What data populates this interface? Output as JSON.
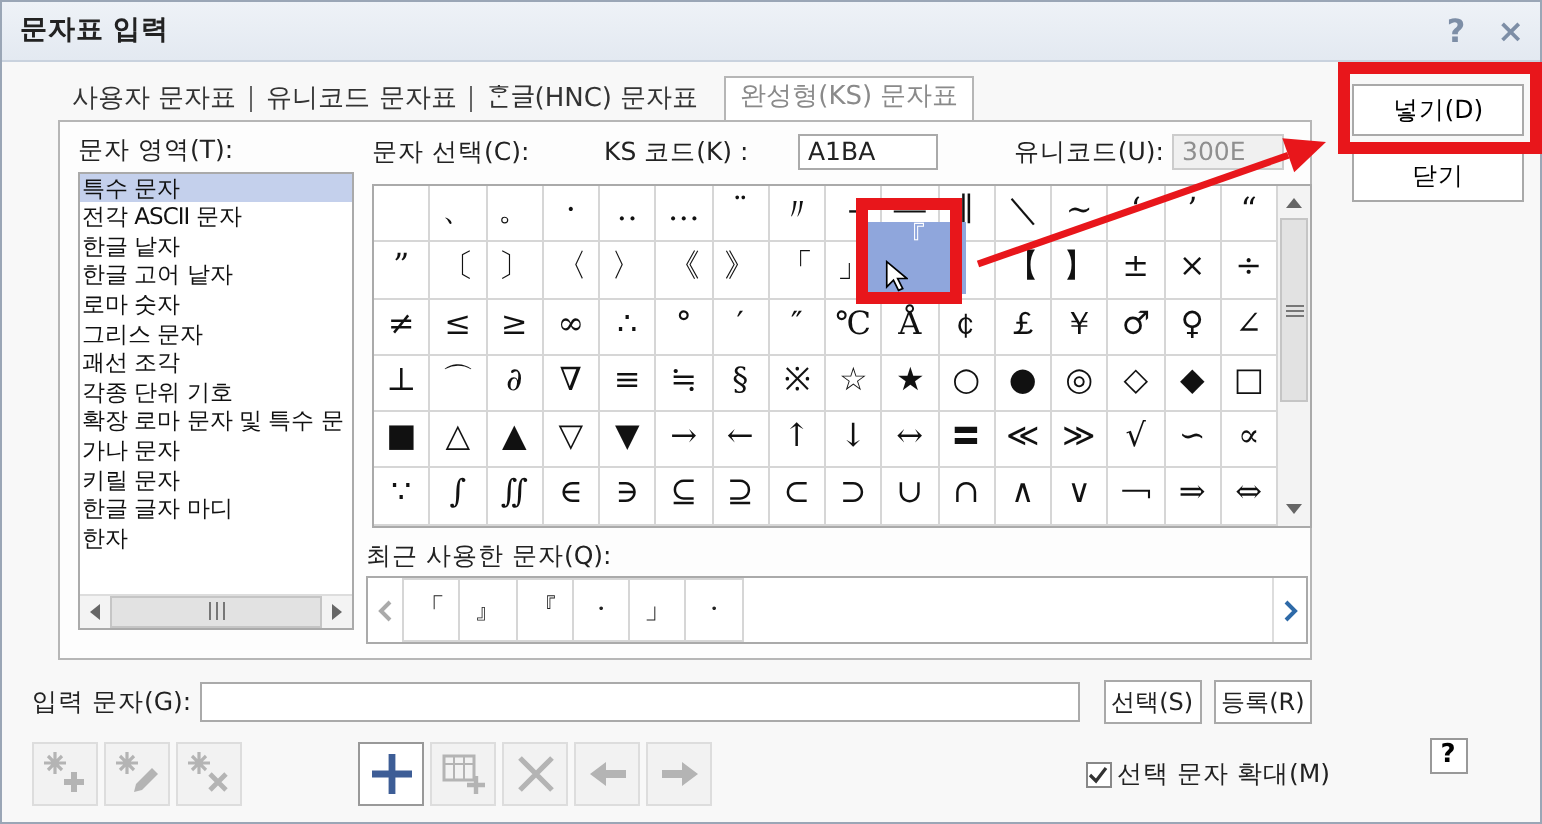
{
  "window": {
    "title": "문자표 입력",
    "help": "?",
    "close": "×"
  },
  "tabs": [
    {
      "label": "사용자 문자표",
      "selected": false
    },
    {
      "label": "유니코드 문자표",
      "selected": false
    },
    {
      "label": "ᄒᆞᆫ글(HNC) 문자표",
      "selected": false
    },
    {
      "label": "완성형(KS) 문자표",
      "selected": true
    }
  ],
  "area": {
    "label": "문자 영역(T):",
    "items": [
      {
        "label": "특수 문자",
        "selected": true
      },
      {
        "label": "전각 ASCII 문자",
        "selected": false
      },
      {
        "label": "한글 낱자",
        "selected": false
      },
      {
        "label": "한글 고어 낱자",
        "selected": false
      },
      {
        "label": "로마 숫자",
        "selected": false
      },
      {
        "label": "그리스 문자",
        "selected": false
      },
      {
        "label": "괘선 조각",
        "selected": false
      },
      {
        "label": "각종 단위 기호",
        "selected": false
      },
      {
        "label": "확장 로마 문자 및 특수 문",
        "selected": false
      },
      {
        "label": "가나 문자",
        "selected": false
      },
      {
        "label": "키릴 문자",
        "selected": false
      },
      {
        "label": "한글 글자 마디",
        "selected": false
      },
      {
        "label": "한자",
        "selected": false
      }
    ]
  },
  "picker": {
    "label": "문자 선택(C):",
    "ks_code": {
      "label": "KS 코드(K) :",
      "value": "A1BA"
    },
    "unicode": {
      "label": "유니코드(U):",
      "value": "300E",
      "disabled": true
    },
    "rows": [
      [
        {
          "selected": false
        },
        {
          "char": "、",
          "selected": false
        },
        {
          "char": "。",
          "selected": false
        },
        {
          "char": "·",
          "selected": false
        },
        {
          "char": "‥",
          "selected": false
        },
        {
          "char": "…",
          "selected": false
        },
        {
          "char": "¨",
          "selected": false
        },
        {
          "char": "〃",
          "selected": false
        },
        {
          "char": "‐",
          "selected": false
        },
        {
          "char": "―",
          "selected": false
        },
        {
          "char": "∥",
          "selected": false
        },
        {
          "char": "＼",
          "selected": false
        },
        {
          "char": "∼",
          "selected": false
        },
        {
          "char": "‘",
          "selected": false
        },
        {
          "char": "’",
          "selected": false
        },
        {
          "char": "“",
          "selected": false
        }
      ],
      [
        {
          "char": "”",
          "selected": false
        },
        {
          "char": "〔",
          "selected": false
        },
        {
          "char": "〕",
          "selected": false
        },
        {
          "char": "〈",
          "selected": false
        },
        {
          "char": "〉",
          "selected": false
        },
        {
          "char": "《",
          "selected": false
        },
        {
          "char": "》",
          "selected": false
        },
        {
          "char": "「",
          "selected": false
        },
        {
          "char": "」",
          "selected": false
        },
        {
          "char": "『",
          "selected": true
        },
        {
          "selected": false
        },
        {
          "char": "【",
          "selected": false
        },
        {
          "char": "】",
          "selected": false
        },
        {
          "char": "±",
          "selected": false
        },
        {
          "char": "×",
          "selected": false
        },
        {
          "char": "÷",
          "selected": false
        }
      ],
      [
        {
          "char": "≠",
          "selected": false
        },
        {
          "char": "≤",
          "selected": false
        },
        {
          "char": "≥",
          "selected": false
        },
        {
          "char": "∞",
          "selected": false
        },
        {
          "char": "∴",
          "selected": false
        },
        {
          "char": "°",
          "selected": false
        },
        {
          "char": "′",
          "selected": false
        },
        {
          "char": "″",
          "selected": false
        },
        {
          "char": "℃",
          "selected": false
        },
        {
          "char": "Å",
          "selected": false
        },
        {
          "char": "￠",
          "selected": false
        },
        {
          "char": "￡",
          "selected": false
        },
        {
          "char": "￥",
          "selected": false
        },
        {
          "char": "♂",
          "selected": false
        },
        {
          "char": "♀",
          "selected": false
        },
        {
          "char": "∠",
          "selected": false
        }
      ],
      [
        {
          "char": "⊥",
          "selected": false
        },
        {
          "char": "⌒",
          "selected": false
        },
        {
          "char": "∂",
          "selected": false
        },
        {
          "char": "∇",
          "selected": false
        },
        {
          "char": "≡",
          "selected": false
        },
        {
          "char": "≒",
          "selected": false
        },
        {
          "char": "§",
          "selected": false
        },
        {
          "char": "※",
          "selected": false
        },
        {
          "char": "☆",
          "selected": false
        },
        {
          "char": "★",
          "selected": false
        },
        {
          "char": "○",
          "selected": false
        },
        {
          "char": "●",
          "selected": false
        },
        {
          "char": "◎",
          "selected": false
        },
        {
          "char": "◇",
          "selected": false
        },
        {
          "char": "◆",
          "selected": false
        },
        {
          "char": "□",
          "selected": false
        }
      ],
      [
        {
          "char": "■",
          "selected": false
        },
        {
          "char": "△",
          "selected": false
        },
        {
          "char": "▲",
          "selected": false
        },
        {
          "char": "▽",
          "selected": false
        },
        {
          "char": "▼",
          "selected": false
        },
        {
          "char": "→",
          "selected": false
        },
        {
          "char": "←",
          "selected": false
        },
        {
          "char": "↑",
          "selected": false
        },
        {
          "char": "↓",
          "selected": false
        },
        {
          "char": "↔",
          "selected": false
        },
        {
          "char": "〓",
          "selected": false
        },
        {
          "char": "≪",
          "selected": false
        },
        {
          "char": "≫",
          "selected": false
        },
        {
          "char": "√",
          "selected": false
        },
        {
          "char": "∽",
          "selected": false
        },
        {
          "char": "∝",
          "selected": false
        }
      ],
      [
        {
          "char": "∵",
          "selected": false
        },
        {
          "char": "∫",
          "selected": false
        },
        {
          "char": "∬",
          "selected": false
        },
        {
          "char": "∈",
          "selected": false
        },
        {
          "char": "∋",
          "selected": false
        },
        {
          "char": "⊆",
          "selected": false
        },
        {
          "char": "⊇",
          "selected": false
        },
        {
          "char": "⊂",
          "selected": false
        },
        {
          "char": "⊃",
          "selected": false
        },
        {
          "char": "∪",
          "selected": false
        },
        {
          "char": "∩",
          "selected": false
        },
        {
          "char": "∧",
          "selected": false
        },
        {
          "char": "∨",
          "selected": false
        },
        {
          "char": "￢",
          "selected": false
        },
        {
          "char": "⇒",
          "selected": false
        },
        {
          "char": "⇔",
          "selected": false
        }
      ]
    ]
  },
  "recent": {
    "label": "최근 사용한 문자(Q):",
    "chars": [
      "「",
      "』",
      "『",
      "·",
      "」",
      "·"
    ]
  },
  "input": {
    "label": "입력 문자(G):",
    "buttons": [
      "선택(S)",
      "등록(R)"
    ]
  },
  "toolbar": [
    {
      "buttons": [
        {
          "kind": "sparkle-add",
          "disabled": true
        },
        {
          "kind": "sparkle-edit",
          "disabled": true
        },
        {
          "kind": "sparkle-remove",
          "disabled": true
        }
      ]
    },
    {
      "buttons": [
        {
          "kind": "add",
          "disabled": false
        },
        {
          "kind": "table-add",
          "disabled": true
        },
        {
          "kind": "delete",
          "disabled": true
        },
        {
          "kind": "left",
          "disabled": true
        },
        {
          "kind": "right",
          "disabled": true
        }
      ]
    }
  ],
  "enlarge": {
    "label": "선택 문자 확대(M)",
    "checked": true
  },
  "help_button": "?",
  "dialog_buttons": [
    {
      "label": "넣기(D)",
      "highlighted": true
    },
    {
      "label": "닫기",
      "highlighted": false
    }
  ]
}
